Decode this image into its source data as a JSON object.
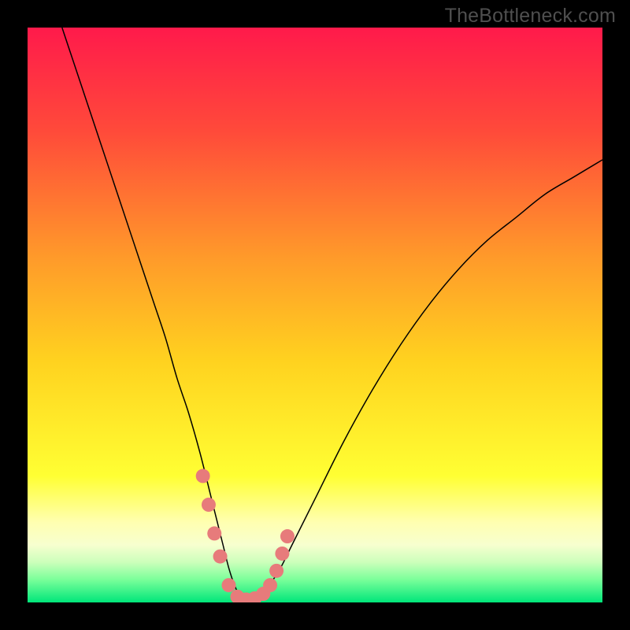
{
  "watermark": "TheBottleneck.com",
  "chart_data": {
    "type": "line",
    "title": "",
    "xlabel": "",
    "ylabel": "",
    "xlim": [
      0,
      100
    ],
    "ylim": [
      0,
      100
    ],
    "background_gradient": {
      "stops": [
        {
          "pos": 0.0,
          "color": "#ff1a4b"
        },
        {
          "pos": 0.18,
          "color": "#ff4a3a"
        },
        {
          "pos": 0.4,
          "color": "#ff9a2a"
        },
        {
          "pos": 0.58,
          "color": "#ffd21f"
        },
        {
          "pos": 0.78,
          "color": "#ffff33"
        },
        {
          "pos": 0.86,
          "color": "#ffffb0"
        },
        {
          "pos": 0.9,
          "color": "#f7ffcf"
        },
        {
          "pos": 0.93,
          "color": "#ccffbb"
        },
        {
          "pos": 0.96,
          "color": "#7bff9a"
        },
        {
          "pos": 1.0,
          "color": "#00e67a"
        }
      ]
    },
    "series": [
      {
        "name": "bottleneck-curve",
        "color": "#000000",
        "stroke_width": 1.5,
        "x": [
          6,
          8,
          10,
          12,
          14,
          16,
          18,
          20,
          22,
          24,
          26,
          28,
          30,
          32,
          33,
          34,
          35,
          36,
          37,
          38,
          40,
          42,
          44,
          46,
          50,
          55,
          60,
          65,
          70,
          75,
          80,
          85,
          90,
          95,
          100
        ],
        "y": [
          100,
          94,
          88,
          82,
          76,
          70,
          64,
          58,
          52,
          46,
          39,
          33,
          26,
          18,
          14,
          10,
          6,
          3,
          1,
          0.5,
          1,
          3,
          6,
          10,
          18,
          28,
          37,
          45,
          52,
          58,
          63,
          67,
          71,
          74,
          77
        ]
      }
    ],
    "markers": {
      "name": "highlight-points",
      "color": "#e77b7b",
      "radius": 9,
      "points": [
        {
          "x": 30.5,
          "y": 22
        },
        {
          "x": 31.5,
          "y": 17
        },
        {
          "x": 32.5,
          "y": 12
        },
        {
          "x": 33.5,
          "y": 8
        },
        {
          "x": 35,
          "y": 3
        },
        {
          "x": 36.5,
          "y": 1
        },
        {
          "x": 38,
          "y": 0.5
        },
        {
          "x": 39.5,
          "y": 0.7
        },
        {
          "x": 41,
          "y": 1.5
        },
        {
          "x": 42.2,
          "y": 3
        },
        {
          "x": 43.3,
          "y": 5.5
        },
        {
          "x": 44.3,
          "y": 8.5
        },
        {
          "x": 45.2,
          "y": 11.5
        }
      ]
    }
  }
}
